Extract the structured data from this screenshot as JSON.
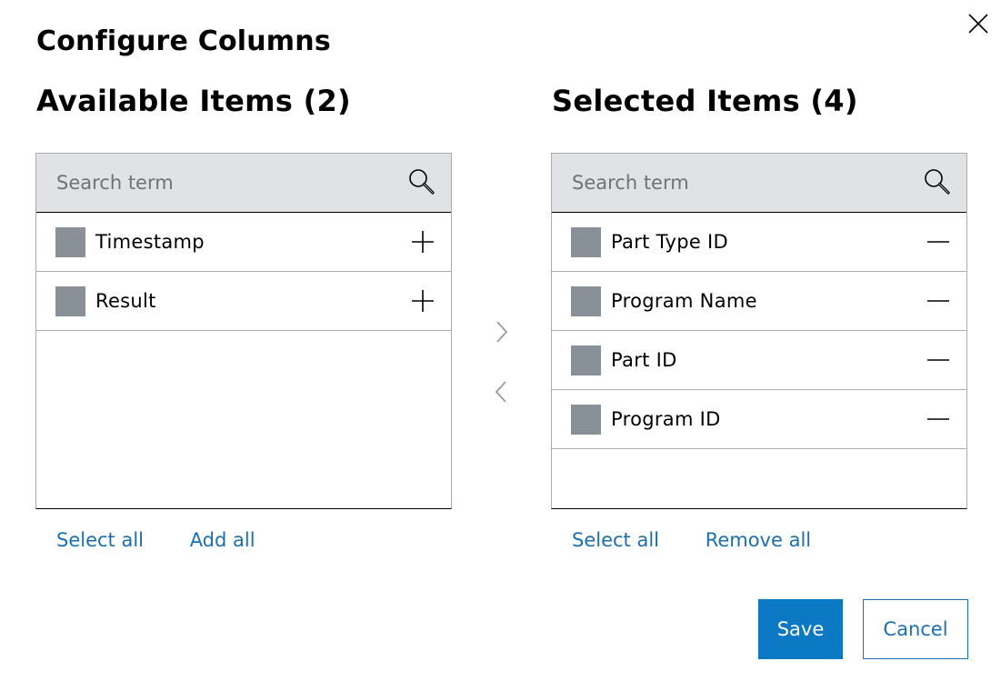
{
  "dialog": {
    "title": "Configure Columns"
  },
  "available": {
    "title": "Available Items (2)",
    "search_placeholder": "Search term",
    "items": [
      {
        "label": "Timestamp"
      },
      {
        "label": "Result"
      }
    ],
    "select_all": "Select all",
    "bulk_action": "Add all"
  },
  "selected": {
    "title": "Selected Items (4)",
    "search_placeholder": "Search term",
    "items": [
      {
        "label": "Part Type ID"
      },
      {
        "label": "Program Name"
      },
      {
        "label": "Part ID"
      },
      {
        "label": "Program ID"
      }
    ],
    "select_all": "Select all",
    "bulk_action": "Remove all"
  },
  "footer": {
    "save_label": "Save",
    "cancel_label": "Cancel"
  },
  "icons": {
    "close": "close-icon",
    "search": "search-icon",
    "add": "plus-icon",
    "remove": "minus-icon",
    "move_right": "chevron-right-icon",
    "move_left": "chevron-left-icon"
  },
  "colors": {
    "accent": "#0a78c2",
    "link": "#1a6fb5",
    "search_bg": "#e0e2e5",
    "checkbox": "#8a9097"
  }
}
